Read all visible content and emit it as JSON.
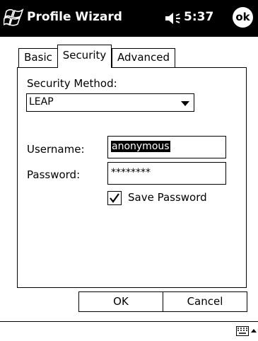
{
  "titlebar": {
    "app_title": "Profile Wizard",
    "time": "5:37",
    "ok_label": "ok"
  },
  "tabs": [
    {
      "label": "Basic",
      "active": false
    },
    {
      "label": "Security",
      "active": true
    },
    {
      "label": "Advanced",
      "active": false
    }
  ],
  "security": {
    "method_label": "Security Method:",
    "method_value": "LEAP",
    "username_label": "Username:",
    "username_value": "anonymous",
    "password_label": "Password:",
    "password_value": "********",
    "save_password_label": "Save Password",
    "save_password_checked": true
  },
  "buttons": {
    "ok": "OK",
    "cancel": "Cancel"
  },
  "icons": [
    "windows-start-icon",
    "speaker-icon",
    "keyboard-icon",
    "sip-arrow-icon",
    "checkmark-icon",
    "dropdown-arrow-icon"
  ]
}
